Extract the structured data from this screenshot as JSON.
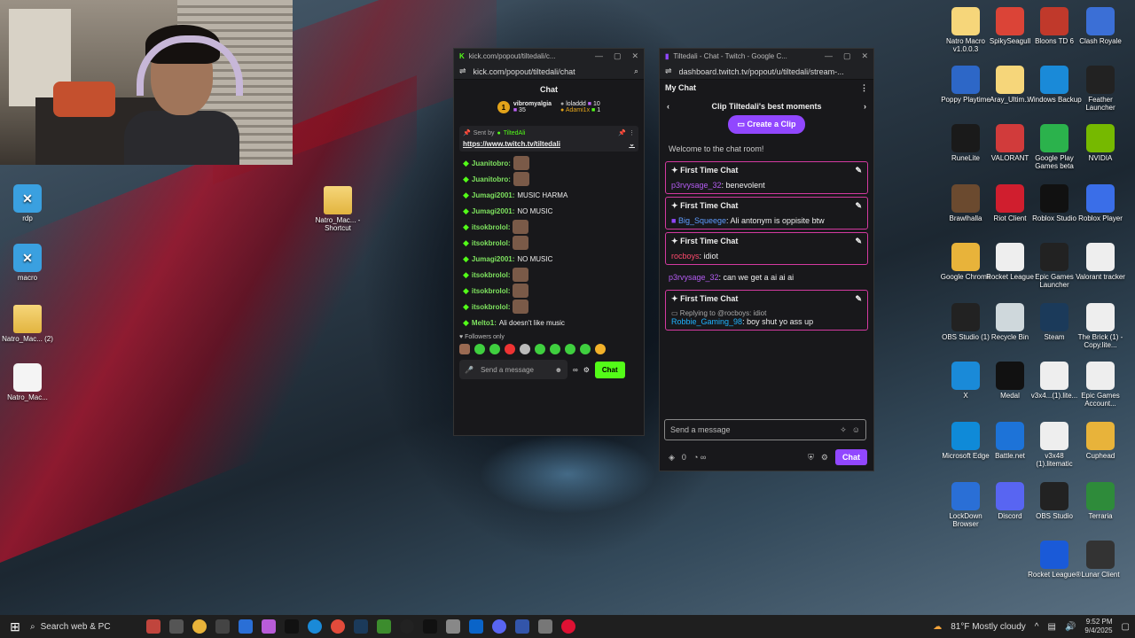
{
  "webcam": {
    "label": "webcam-overlay"
  },
  "desktop_icons_left": [
    {
      "label": "rdp",
      "name": "rdp"
    },
    {
      "label": "macro",
      "name": "macro"
    },
    {
      "label": "Natro_Mac... (2)",
      "name": "natro-2"
    },
    {
      "label": "Natro_Mac...",
      "name": "natro"
    }
  ],
  "desktop_icon_mid": {
    "label": "Natro_Mac... - Shortcut"
  },
  "desktop_icons_right": [
    [
      "Natro Macro v1.0.0.3",
      "SpikySeagull",
      "Bloons TD 6",
      "Clash Royale"
    ],
    [
      "Poppy Playtime",
      "Aray_Ultim...",
      "Windows Backup",
      "Feather Launcher"
    ],
    [
      "RuneLite",
      "VALORANT",
      "Google Play Games beta",
      "NVIDIA"
    ],
    [
      "Brawlhalla",
      "Riot Client",
      "Roblox Studio",
      "Roblox Player"
    ],
    [
      "Google Chrome",
      "Rocket League",
      "Epic Games Launcher",
      "Valorant tracker"
    ],
    [
      "OBS Studio (1)",
      "Recycle Bin",
      "Steam",
      "The Brick (1) - Copy.lite..."
    ],
    [
      "X",
      "Medal",
      "v3x4...(1).lite...",
      "Epic Games Account..."
    ],
    [
      "Microsoft Edge",
      "Battle.net",
      "v3x48 (1).litematic",
      "Cuphead"
    ],
    [
      "LockDown Browser",
      "Discord",
      "OBS Studio",
      "Terraria"
    ],
    [
      "",
      "",
      "Rocket League®",
      "Lunar Client"
    ]
  ],
  "kick": {
    "window_title": "kick.com/popout/tiltedali/c...",
    "url": "kick.com/popout/tiltedali/chat",
    "header": "Chat",
    "leader1_name": "vibromyalgia",
    "leader1_count": "35",
    "leader2_name": "loladdd",
    "leader2_count": "10",
    "leader3_name": "Adami1x",
    "leader3_count": "1",
    "pinned_sent_by": "Sent by",
    "pinned_user": "TiltedAli",
    "pinned_link": "https://www.twitch.tv/tiltedali",
    "messages": [
      {
        "user": "Juanitobro:",
        "text": ""
      },
      {
        "user": "Juanitobro:",
        "text": ""
      },
      {
        "user": "Jumagi2001:",
        "text": "MUSIC HARMA"
      },
      {
        "user": "Jumagi2001:",
        "text": "NO MUSIC"
      },
      {
        "user": "itsokbrolol:",
        "text": ""
      },
      {
        "user": "itsokbrolol:",
        "text": ""
      },
      {
        "user": "Jumagi2001:",
        "text": "NO MUSIC"
      },
      {
        "user": "itsokbrolol:",
        "text": ""
      },
      {
        "user": "itsokbrolol:",
        "text": ""
      },
      {
        "user": "itsokbrolol:",
        "text": ""
      },
      {
        "user": "Melto1:",
        "text": "Ali doesn't like music"
      }
    ],
    "followers_only": "Followers only",
    "input_placeholder": "Send a message",
    "chat_button": "Chat"
  },
  "twitch": {
    "window_title": "Tiltedali - Chat - Twitch - Google C...",
    "url": "dashboard.twitch.tv/popout/u/tiltedali/stream-...",
    "header": "My Chat",
    "clip_title": "Clip Tiltedali's best moments",
    "clip_button": "Create a Clip",
    "welcome": "Welcome to the chat room!",
    "first_time_label": "First Time Chat",
    "ftc1_user": "p3rvysage_32",
    "ftc1_text": ": benevolent",
    "ftc2_user": "Big_Squeege",
    "ftc2_text": ": Ali antonym is oppisite btw",
    "ftc3_user": "rocboys",
    "ftc3_text": ": idiot",
    "plain_user": "p3rvysage_32",
    "plain_text": ": can we get a ai ai ai",
    "ftc4_reply": "Replying to @rocboys: idiot",
    "ftc4_user": "Robbie_Gaming_98",
    "ftc4_text": ": boy shut yo ass up",
    "input_placeholder": "Send a message",
    "points": "0",
    "chat_button": "Chat"
  },
  "taskbar": {
    "search_placeholder": "Search web & PC",
    "weather": "81°F  Mostly cloudy",
    "time": "9:52 PM",
    "date": "9/4/2025"
  }
}
